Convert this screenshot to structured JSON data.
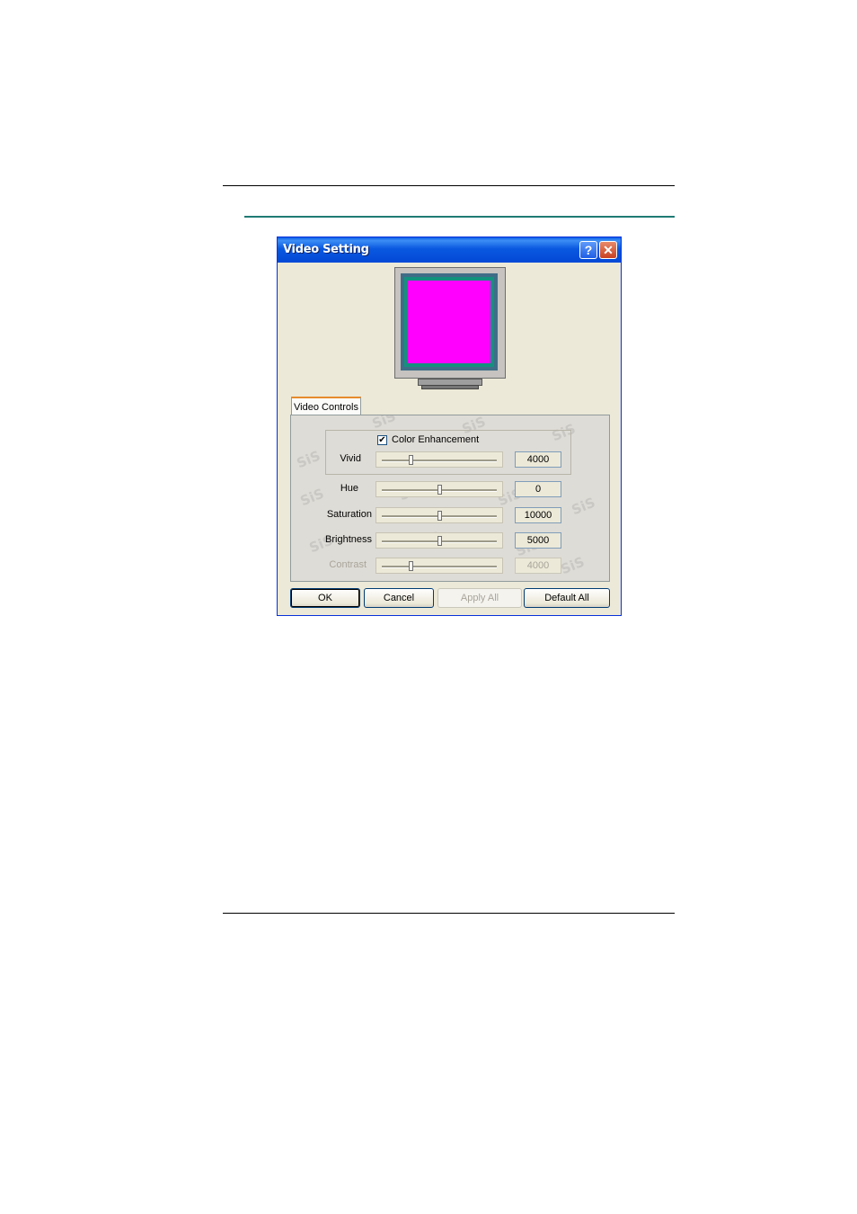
{
  "dialog": {
    "title": "Video Setting",
    "help_glyph": "?",
    "close_glyph": "✕"
  },
  "preview": {
    "screen_color": "#ff00ff",
    "frame_color": "#14907f"
  },
  "tabs": [
    {
      "label": "Video Controls",
      "selected": true
    }
  ],
  "watermark": "SiS",
  "color_enhancement": {
    "label": "Color Enhancement",
    "checked": true,
    "check_glyph": "✔"
  },
  "controls": {
    "vivid": {
      "label": "Vivid",
      "value": "4000",
      "position": 0.25,
      "enabled": true
    },
    "hue": {
      "label": "Hue",
      "value": "0",
      "position": 0.5,
      "enabled": true
    },
    "saturation": {
      "label": "Saturation",
      "value": "10000",
      "position": 0.5,
      "enabled": true
    },
    "brightness": {
      "label": "Brightness",
      "value": "5000",
      "position": 0.5,
      "enabled": true
    },
    "contrast": {
      "label": "Contrast",
      "value": "4000",
      "position": 0.25,
      "enabled": false
    }
  },
  "buttons": {
    "ok": "OK",
    "cancel": "Cancel",
    "apply_all": "Apply All",
    "default_all": "Default All"
  }
}
